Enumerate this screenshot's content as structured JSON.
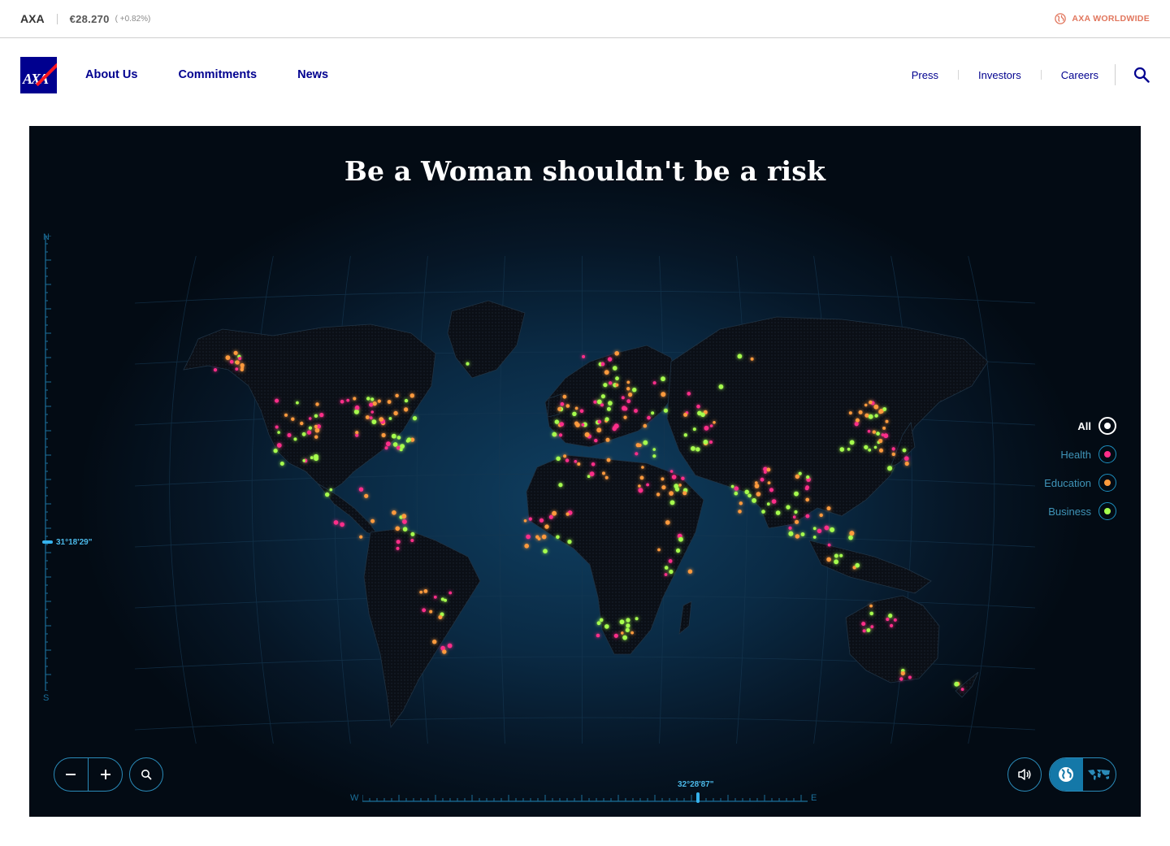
{
  "topbar": {
    "brand": "AXA",
    "price": "€28.270",
    "change": "( +0.82%)",
    "worldwide_label": "AXA WORLDWIDE",
    "worldwide_icon": "globe-icon"
  },
  "nav": {
    "logo_text": "AXA",
    "main_links": [
      "About Us",
      "Commitments",
      "News"
    ],
    "secondary_links": [
      "Press",
      "Investors",
      "Careers"
    ],
    "search_icon": "search-icon"
  },
  "map": {
    "title": "Be a Woman shouldn't be a risk",
    "lat_north": "N",
    "lat_south": "S",
    "lat_readout": "31°18'29\"",
    "lon_west": "W",
    "lon_east": "E",
    "lon_readout": "32°28'87\"",
    "legend": [
      {
        "label": "All",
        "color": "#ffffff",
        "active": true
      },
      {
        "label": "Health",
        "color": "#ff2e8a",
        "active": false
      },
      {
        "label": "Education",
        "color": "#ff9a3c",
        "active": false
      },
      {
        "label": "Business",
        "color": "#a6ff4d",
        "active": false
      }
    ],
    "controls": {
      "zoom_out_icon": "minus-icon",
      "zoom_in_icon": "plus-icon",
      "search_icon": "search-icon",
      "sound_icon": "speaker-icon",
      "globe_view_icon": "globe-icon",
      "flat_view_icon": "world-map-icon"
    }
  },
  "colors": {
    "axa_blue": "#00008f",
    "axa_red": "#ff1721",
    "worldwide_orange": "#e1765d",
    "map_accent": "#36b3ee"
  }
}
